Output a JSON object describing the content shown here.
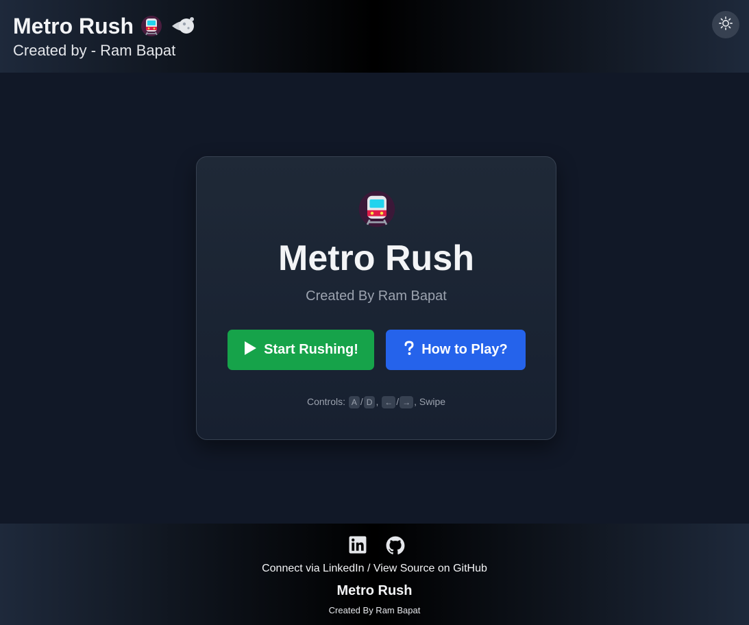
{
  "header": {
    "title": "Metro Rush",
    "subtitle": "Created by - Ram Bapat",
    "icons": [
      "metro-icon",
      "comet-icon"
    ],
    "theme_toggle_icon": "sun-icon"
  },
  "card": {
    "icon": "metro-icon",
    "title": "Metro Rush",
    "subtitle": "Created By Ram Bapat",
    "start_label": "Start Rushing!",
    "how_label": "How to Play?",
    "controls": {
      "prefix": "Controls:",
      "key_a": "A",
      "sep1": "/",
      "key_d": "D",
      "comma1": ",",
      "key_left": "←",
      "sep2": "/",
      "key_right": "→",
      "suffix": ", Swipe"
    }
  },
  "footer": {
    "social_icons": [
      "linkedin-icon",
      "github-icon"
    ],
    "connect_prefix": "Connect via ",
    "linkedin_label": "LinkedIn",
    "separator": " / ",
    "github_label": "View Source on GitHub",
    "title": "Metro Rush",
    "subtitle": "Created By Ram Bapat"
  },
  "colors": {
    "background": "#111827",
    "card": "#1f2937",
    "start_button": "#16a34a",
    "how_button": "#2563eb",
    "muted_text": "#9ca3af"
  }
}
